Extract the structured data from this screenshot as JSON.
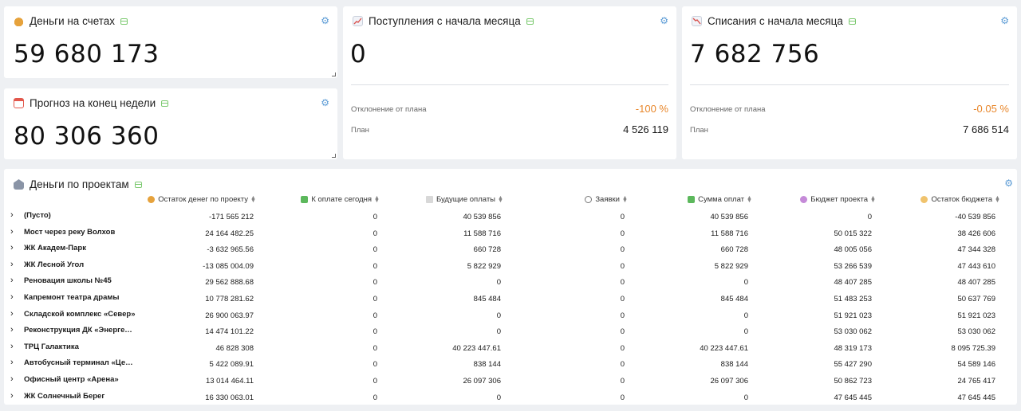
{
  "cards": {
    "balance": {
      "icon": "money-bag-icon",
      "title": "Деньги на счетах",
      "value": "59 680 173"
    },
    "forecast": {
      "icon": "calendar-icon",
      "title": "Прогноз на конец недели",
      "value": "80 306 360"
    },
    "income": {
      "icon": "chart-up-icon",
      "title": "Поступления с начала месяца",
      "value": "0",
      "deviation_label": "Отклонение от плана",
      "deviation_value": "-100 %",
      "plan_label": "План",
      "plan_value": "4 526 119"
    },
    "expense": {
      "icon": "chart-down-icon",
      "title": "Списания с начала месяца",
      "value": "7 682 756",
      "deviation_label": "Отклонение от плана",
      "deviation_value": "-0.05 %",
      "plan_label": "План",
      "plan_value": "7 686 514"
    }
  },
  "projects": {
    "icon": "bank-icon",
    "title": "Деньги по проектам",
    "columns": [
      "Остаток денег по проекту",
      "К оплате сегодня",
      "Будущие оплаты",
      "Заявки",
      "Сумма оплат",
      "Бюджет проекта",
      "Остаток бюджета"
    ],
    "rows": [
      {
        "name": "(Пусто)",
        "values": [
          "-171 565 212",
          "0",
          "40 539 856",
          "0",
          "40 539 856",
          "0",
          "-40 539 856"
        ]
      },
      {
        "name": "Мост через реку Волхов",
        "values": [
          "24 164 482.25",
          "0",
          "11 588 716",
          "0",
          "11 588 716",
          "50 015 322",
          "38 426 606"
        ]
      },
      {
        "name": "ЖК Академ-Парк",
        "values": [
          "-3 632 965.56",
          "0",
          "660 728",
          "0",
          "660 728",
          "48 005 056",
          "47 344 328"
        ]
      },
      {
        "name": "ЖК Лесной Угол",
        "values": [
          "-13 085 004.09",
          "0",
          "5 822 929",
          "0",
          "5 822 929",
          "53 266 539",
          "47 443 610"
        ]
      },
      {
        "name": "Реновация школы №45",
        "values": [
          "29 562 888.68",
          "0",
          "0",
          "0",
          "0",
          "48 407 285",
          "48 407 285"
        ]
      },
      {
        "name": "Капремонт театра драмы",
        "values": [
          "10 778 281.62",
          "0",
          "845 484",
          "0",
          "845 484",
          "51 483 253",
          "50 637 769"
        ]
      },
      {
        "name": "Складской комплекс «Север»",
        "values": [
          "26 900 063.97",
          "0",
          "0",
          "0",
          "0",
          "51 921 023",
          "51 921 023"
        ]
      },
      {
        "name": "Реконструкция ДК «Энергет…",
        "values": [
          "14 474 101.22",
          "0",
          "0",
          "0",
          "0",
          "53 030 062",
          "53 030 062"
        ]
      },
      {
        "name": "ТРЦ Галактика",
        "values": [
          "46 828 308",
          "0",
          "40 223 447.61",
          "0",
          "40 223 447.61",
          "48 319 173",
          "8 095 725.39"
        ]
      },
      {
        "name": "Автобусный терминал «Цент…",
        "values": [
          "5 422 089.91",
          "0",
          "838 144",
          "0",
          "838 144",
          "55 427 290",
          "54 589 146"
        ]
      },
      {
        "name": "Офисный центр «Арена»",
        "values": [
          "13 014 464.11",
          "0",
          "26 097 306",
          "0",
          "26 097 306",
          "50 862 723",
          "24 765 417"
        ]
      },
      {
        "name": "ЖК Солнечный Берег",
        "values": [
          "16 330 063.01",
          "0",
          "0",
          "0",
          "0",
          "47 645 445",
          "47 645 445"
        ]
      }
    ]
  }
}
